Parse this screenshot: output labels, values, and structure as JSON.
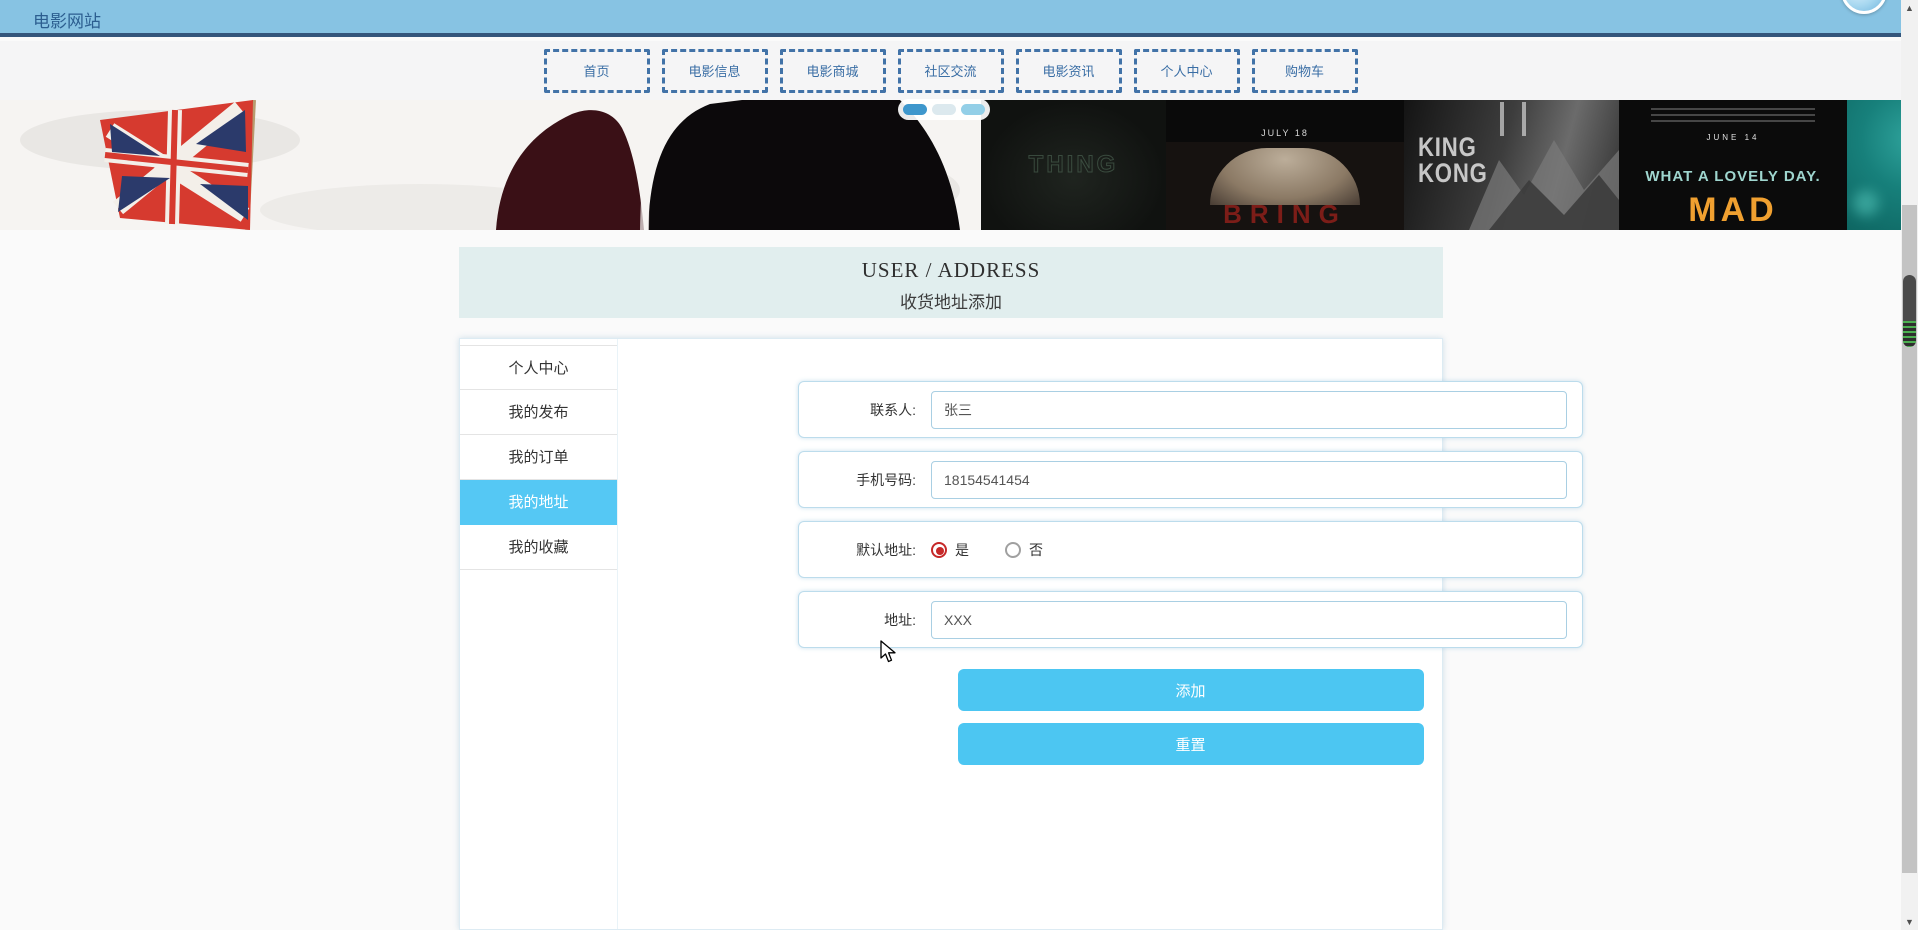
{
  "header": {
    "title": "电影网站"
  },
  "nav": {
    "items": [
      {
        "label": "首页"
      },
      {
        "label": "电影信息"
      },
      {
        "label": "电影商城"
      },
      {
        "label": "社区交流"
      },
      {
        "label": "电影资讯"
      },
      {
        "label": "个人中心"
      },
      {
        "label": "购物车"
      }
    ]
  },
  "carousel": {
    "posters": [
      {
        "name": "kingsman-banner"
      },
      {
        "name": "the-thing",
        "title": "THING"
      },
      {
        "name": "bring",
        "date": "JULY 18",
        "title": "BRING"
      },
      {
        "name": "king-kong",
        "title_line1": "KING",
        "title_line2": "KONG"
      },
      {
        "name": "mad-max",
        "release": "JUNE 14",
        "tagline": "WHAT A LOVELY DAY.",
        "title": "MAD"
      },
      {
        "name": "teal-poster"
      }
    ],
    "dots": [
      {
        "active": true
      },
      {
        "active": false
      },
      {
        "active": false
      }
    ]
  },
  "page_header": {
    "title_en": "USER / ADDRESS",
    "title_zh": "收货地址添加"
  },
  "sidebar": {
    "items": [
      {
        "label": "个人中心",
        "active": false
      },
      {
        "label": "我的发布",
        "active": false
      },
      {
        "label": "我的订单",
        "active": false
      },
      {
        "label": "我的地址",
        "active": true
      },
      {
        "label": "我的收藏",
        "active": false
      }
    ]
  },
  "form": {
    "contact": {
      "label": "联系人:",
      "value": "张三"
    },
    "phone": {
      "label": "手机号码:",
      "value": "18154541454"
    },
    "default_address": {
      "label": "默认地址:",
      "options": [
        {
          "label": "是",
          "checked": true
        },
        {
          "label": "否",
          "checked": false
        }
      ]
    },
    "address": {
      "label": "地址:",
      "value": "XXX"
    },
    "submit_label": "添加",
    "reset_label": "重置"
  },
  "colors": {
    "accent": "#4cc6f2",
    "header_bg": "#87c3e3",
    "header_border": "#34567c",
    "nav_link": "#3a6ea5",
    "active_menu_bg": "#55c8f4",
    "radio_checked": "#c62828"
  }
}
